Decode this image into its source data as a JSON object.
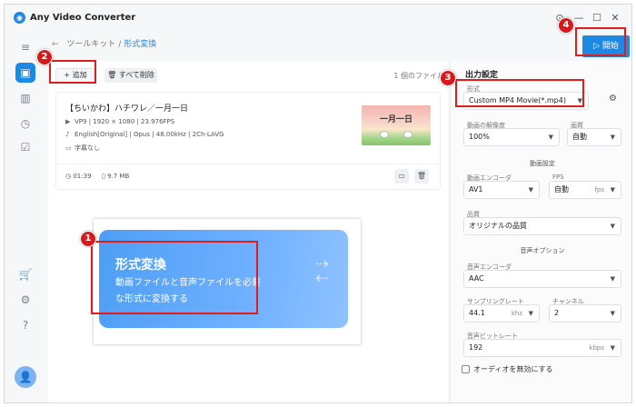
{
  "app": {
    "title": "Any Video Converter",
    "logo_glyph": "◉"
  },
  "window_controls": {
    "pin": "⊙",
    "minimize": "—",
    "maximize": "☐",
    "close": "✕"
  },
  "breadcrumb": {
    "back": "←",
    "parent": "ツールキット",
    "sep": "/",
    "current": "形式変換"
  },
  "toolbar": {
    "add_label": "+ 追加",
    "delete_all_label": "🗑 すべて削除",
    "file_count": "1 個のファイル"
  },
  "file": {
    "title": "【ちいかわ】ハチワレ／一月一日",
    "video": "VP9 | 1920 × 1080 | 23.976FPS",
    "audio": "English[Original] | Opus | 48.00kHz | 2Ch-LAVG",
    "subtitle": "字幕なし",
    "duration": "01:39",
    "size": "9.7 MB",
    "thumb_text": "一月一日"
  },
  "promo": {
    "title": "形式変換",
    "line1": "動画ファイルと音声ファイルを必要",
    "line2": "な形式に変換する"
  },
  "output": {
    "title": "出力設定",
    "format_label": "形式",
    "format_value": "Custom MP4 Movie(*.mp4)",
    "resolution_label": "動画の解像度",
    "resolution_value": "100%",
    "quality_label": "画質",
    "quality_value": "自動",
    "video_section": "動画設定",
    "encoder_label": "動画エンコーダ",
    "encoder_value": "AV1",
    "fps_label": "FPS",
    "fps_value": "自動",
    "fps_unit": "fps",
    "vquality_label": "品質",
    "vquality_value": "オリジナルの品質",
    "audio_section": "音声オプション",
    "aencoder_label": "音声エンコーダ",
    "aencoder_value": "AAC",
    "samplerate_label": "サンプリングレート",
    "samplerate_value": "44.1",
    "samplerate_unit": "khz",
    "channel_label": "チャンネル",
    "channel_value": "2",
    "bitrate_label": "音声ビットレート",
    "bitrate_value": "192",
    "bitrate_unit": "kbps",
    "disable_audio": "オーディオを無効にする"
  },
  "convert_button": "▷ 開始",
  "callouts": [
    "1",
    "2",
    "3",
    "4"
  ],
  "colors": {
    "accent": "#1e88e5",
    "callout": "#e21b1b"
  }
}
